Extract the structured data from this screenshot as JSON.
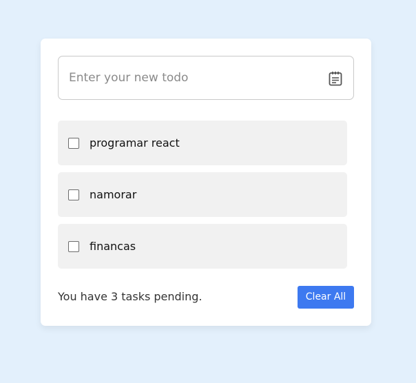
{
  "input": {
    "placeholder": "Enter your new todo",
    "icon": "calendar-icon"
  },
  "tasks": [
    {
      "label": "programar react",
      "checked": false
    },
    {
      "label": "namorar",
      "checked": false
    },
    {
      "label": "financas",
      "checked": false
    }
  ],
  "footer": {
    "pending_text": "You have 3 tasks pending.",
    "clear_label": "Clear All"
  },
  "colors": {
    "background": "#e3f0fc",
    "card": "#ffffff",
    "task_bg": "#f1f1f1",
    "accent": "#3d79f0"
  }
}
